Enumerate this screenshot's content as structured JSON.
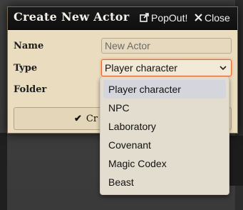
{
  "window": {
    "title": "Create New Actor",
    "popout_label": "PopOut!",
    "close_label": "Close"
  },
  "form": {
    "name_label": "Name",
    "name_placeholder": "New Actor",
    "type_label": "Type",
    "type_value": "Player character",
    "folder_label": "Folder",
    "create_button_label": "Cr"
  },
  "dropdown": {
    "options": [
      "Player character",
      "NPC",
      "Laboratory",
      "Covenant",
      "Magic Codex",
      "Beast"
    ],
    "selected_index": 0
  },
  "icons": {
    "popout": "external-link-icon",
    "close": "close-icon",
    "select_caret": "chevron-down-icon",
    "create": "check-icon"
  },
  "colors": {
    "titlebar": "#111111",
    "panel": "#e9dcbf",
    "focus_border": "#e06a38"
  }
}
